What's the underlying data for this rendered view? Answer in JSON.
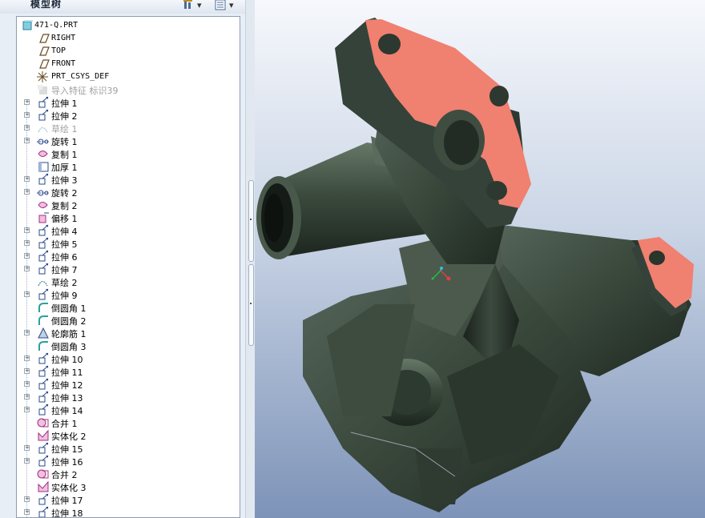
{
  "panel": {
    "title": "模型树",
    "settings_icon": "tree-settings-icon",
    "columns_icon": "tree-columns-icon"
  },
  "tree": {
    "items": [
      {
        "label": "471-Q.PRT",
        "icon": "part-icon",
        "expander": false,
        "mono": true,
        "dim": false
      },
      {
        "label": "RIGHT",
        "icon": "datum-plane-icon",
        "expander": false,
        "mono": true,
        "dim": false
      },
      {
        "label": "TOP",
        "icon": "datum-plane-icon",
        "expander": false,
        "mono": true,
        "dim": false
      },
      {
        "label": "FRONT",
        "icon": "datum-plane-icon",
        "expander": false,
        "mono": true,
        "dim": false
      },
      {
        "label": "PRT_CSYS_DEF",
        "icon": "csys-icon",
        "expander": false,
        "mono": true,
        "dim": false
      },
      {
        "label": "导入特征 标识39",
        "icon": "import-icon",
        "expander": false,
        "mono": false,
        "dim": true
      },
      {
        "label": "拉伸 1",
        "icon": "extrude-icon",
        "expander": true,
        "mono": false,
        "dim": false
      },
      {
        "label": "拉伸 2",
        "icon": "extrude-icon",
        "expander": true,
        "mono": false,
        "dim": false
      },
      {
        "label": "草绘 1",
        "icon": "sketch-icon",
        "expander": true,
        "mono": false,
        "dim": true
      },
      {
        "label": "旋转 1",
        "icon": "revolve-icon",
        "expander": true,
        "mono": false,
        "dim": false
      },
      {
        "label": "复制 1",
        "icon": "copy-icon",
        "expander": false,
        "mono": false,
        "dim": false
      },
      {
        "label": "加厚 1",
        "icon": "thicken-icon",
        "expander": false,
        "mono": false,
        "dim": false
      },
      {
        "label": "拉伸 3",
        "icon": "extrude-icon",
        "expander": true,
        "mono": false,
        "dim": false
      },
      {
        "label": "旋转 2",
        "icon": "revolve-icon",
        "expander": true,
        "mono": false,
        "dim": false
      },
      {
        "label": "复制 2",
        "icon": "copy-icon",
        "expander": false,
        "mono": false,
        "dim": false
      },
      {
        "label": "偏移 1",
        "icon": "offset-icon",
        "expander": false,
        "mono": false,
        "dim": false
      },
      {
        "label": "拉伸 4",
        "icon": "extrude-icon",
        "expander": true,
        "mono": false,
        "dim": false
      },
      {
        "label": "拉伸 5",
        "icon": "extrude-icon",
        "expander": true,
        "mono": false,
        "dim": false
      },
      {
        "label": "拉伸 6",
        "icon": "extrude-icon",
        "expander": true,
        "mono": false,
        "dim": false
      },
      {
        "label": "拉伸 7",
        "icon": "extrude-icon",
        "expander": true,
        "mono": false,
        "dim": false
      },
      {
        "label": "草绘 2",
        "icon": "sketch-icon",
        "expander": false,
        "mono": false,
        "dim": false
      },
      {
        "label": "拉伸 9",
        "icon": "extrude-icon",
        "expander": true,
        "mono": false,
        "dim": false
      },
      {
        "label": "倒圆角 1",
        "icon": "round-icon",
        "expander": false,
        "mono": false,
        "dim": false
      },
      {
        "label": "倒圆角 2",
        "icon": "round-icon",
        "expander": false,
        "mono": false,
        "dim": false
      },
      {
        "label": "轮廓筋 1",
        "icon": "rib-icon",
        "expander": true,
        "mono": false,
        "dim": false
      },
      {
        "label": "倒圆角 3",
        "icon": "round-icon",
        "expander": false,
        "mono": false,
        "dim": false
      },
      {
        "label": "拉伸 10",
        "icon": "extrude-icon",
        "expander": true,
        "mono": false,
        "dim": false
      },
      {
        "label": "拉伸 11",
        "icon": "extrude-icon",
        "expander": true,
        "mono": false,
        "dim": false
      },
      {
        "label": "拉伸 12",
        "icon": "extrude-icon",
        "expander": true,
        "mono": false,
        "dim": false
      },
      {
        "label": "拉伸 13",
        "icon": "extrude-icon",
        "expander": true,
        "mono": false,
        "dim": false
      },
      {
        "label": "拉伸 14",
        "icon": "extrude-icon",
        "expander": true,
        "mono": false,
        "dim": false
      },
      {
        "label": "合并 1",
        "icon": "merge-icon",
        "expander": false,
        "mono": false,
        "dim": false
      },
      {
        "label": "实体化 2",
        "icon": "solidify-icon",
        "expander": false,
        "mono": false,
        "dim": false
      },
      {
        "label": "拉伸 15",
        "icon": "extrude-icon",
        "expander": true,
        "mono": false,
        "dim": false
      },
      {
        "label": "拉伸 16",
        "icon": "extrude-icon",
        "expander": true,
        "mono": false,
        "dim": false
      },
      {
        "label": "合并 2",
        "icon": "merge-icon",
        "expander": false,
        "mono": false,
        "dim": false
      },
      {
        "label": "实体化 3",
        "icon": "solidify-icon",
        "expander": false,
        "mono": false,
        "dim": false
      },
      {
        "label": "拉伸 17",
        "icon": "extrude-icon",
        "expander": true,
        "mono": false,
        "dim": false
      },
      {
        "label": "拉伸 18",
        "icon": "extrude-icon",
        "expander": true,
        "mono": false,
        "dim": false
      }
    ]
  },
  "viewport": {
    "model_color": "#3d4c3f",
    "highlight_color": "#f08070",
    "background_top": "#f6f8fc",
    "background_bottom": "#7d93b8"
  }
}
